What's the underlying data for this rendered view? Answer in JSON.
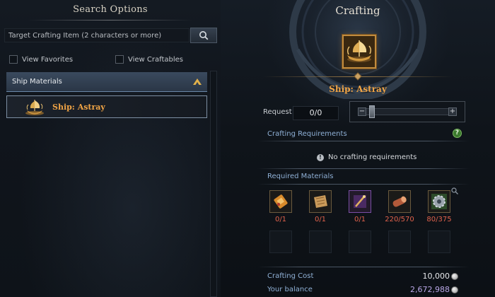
{
  "search": {
    "title": "Search Options",
    "placeholder": "Target Crafting Item (2 characters or more)",
    "view_favorites": "View Favorites",
    "view_craftables": "View Craftables"
  },
  "list": {
    "category": "Ship Materials",
    "items": [
      {
        "label": "Ship: Astray",
        "icon": "ship-icon"
      }
    ]
  },
  "crafting": {
    "title": "Crafting",
    "item_name": "Ship: Astray",
    "request_label": "Request",
    "request_value": "0/0",
    "requirements_label": "Crafting Requirements",
    "no_requirements": "No crafting requirements",
    "materials_label": "Required Materials",
    "materials": [
      {
        "icon": "scroll-icon",
        "count": "0/1"
      },
      {
        "icon": "map-icon",
        "count": "0/1"
      },
      {
        "icon": "wand-icon",
        "count": "0/1"
      },
      {
        "icon": "timber-icon",
        "count": "220/570"
      },
      {
        "icon": "gear-icon",
        "count": "80/375"
      }
    ],
    "cost_label": "Crafting Cost",
    "cost_value": "10,000",
    "balance_label": "Your balance",
    "balance_value": "2,672,988"
  },
  "colors": {
    "item_gold": "#f0a445",
    "section_blue": "#8fb0d6",
    "shortfall_red": "#e0624c",
    "balance_purple": "#b8a6e6"
  }
}
